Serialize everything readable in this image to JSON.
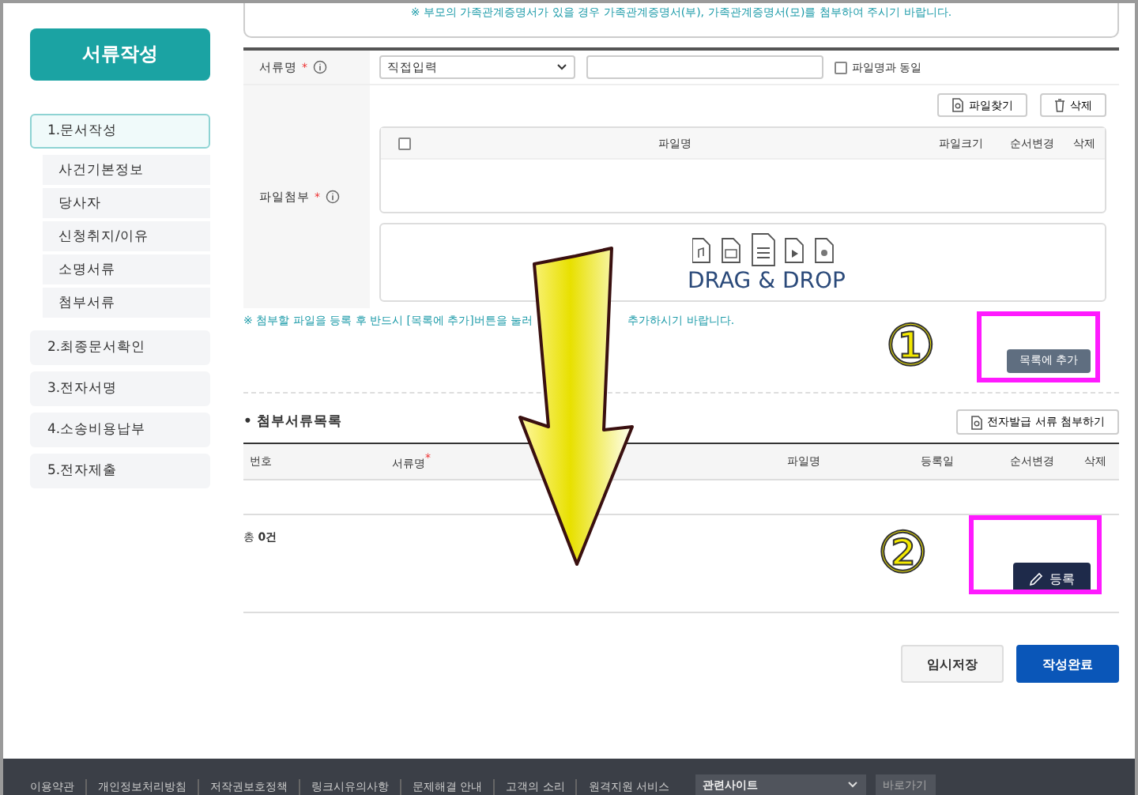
{
  "sidebar": {
    "title": "서류작성",
    "steps": [
      {
        "label": "1.문서작성",
        "selected": true,
        "children": [
          {
            "label": "사건기본정보"
          },
          {
            "label": "당사자"
          },
          {
            "label": "신청취지/이유"
          },
          {
            "label": "소명서류"
          },
          {
            "label": "첨부서류"
          }
        ]
      },
      {
        "label": "2.최종문서확인",
        "selected": false
      },
      {
        "label": "3.전자서명",
        "selected": false
      },
      {
        "label": "4.소송비용납부",
        "selected": false
      },
      {
        "label": "5.전자제출",
        "selected": false
      }
    ]
  },
  "top_notice": "※ 부모의 가족관계증명서가 있을 경우 가족관계증명서(부), 가족관계증명서(모)를 첨부하여 주시기 바랍니다.",
  "form": {
    "doc_name_label": "서류명",
    "doc_type": "직접입력",
    "same_as_file": {
      "label": "파일명과 동일",
      "checked": false
    },
    "attach_label": "파일첨부",
    "find_button": "파일찾기",
    "delete_button": "삭제",
    "header_checked": false,
    "file_columns": [
      "파일명",
      "파일크기",
      "순서변경",
      "삭제"
    ],
    "drop_text": "DRAG & DROP"
  },
  "attach_notice": [
    "※ 첨부할 파일을 등록 후 반드시 [목록에 추가]버튼을 눌러",
    "추가하시기 바랍니다."
  ],
  "add_to_list_button": "목록에 추가",
  "doc_list": {
    "title": "첨부서류목록",
    "e_issue_button": "전자발급 서류 첨부하기",
    "columns": [
      "번호",
      "서류명",
      "파일명",
      "등록일",
      "순서변경",
      "삭제"
    ],
    "total_label": "총",
    "total_count": "0건"
  },
  "register_button": "등록",
  "annotations": [
    "①",
    "②"
  ],
  "marks": {
    "required": "*",
    "bullet": "•"
  },
  "actions": [
    {
      "label": "임시저장",
      "kind": "secondary"
    },
    {
      "label": "작성완료",
      "kind": "primary"
    }
  ],
  "footer": {
    "links": [
      "이용약관",
      "개인정보처리방침",
      "저작권보호정책",
      "링크시유의사항",
      "문제해결 안내",
      "고객의 소리",
      "원격지원 서비스"
    ],
    "site_select": "관련사이트",
    "go_button": "바로가기"
  }
}
